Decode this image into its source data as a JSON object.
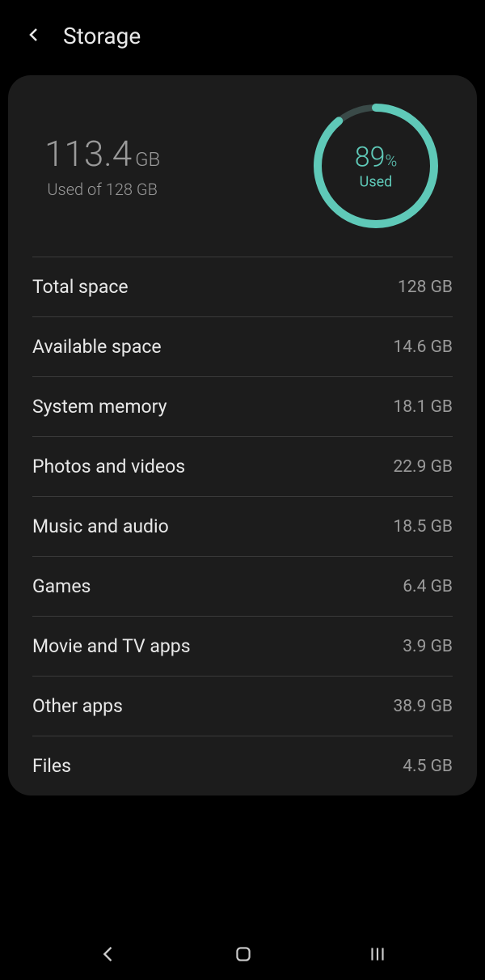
{
  "header": {
    "title": "Storage"
  },
  "usage": {
    "amount": "113.4",
    "unit": "GB",
    "subtitle": "Used of 128 GB",
    "percent": "89",
    "percent_sign": "%",
    "used_label": "Used",
    "gauge_fraction": 0.89
  },
  "rows": [
    {
      "label": "Total space",
      "value": "128 GB"
    },
    {
      "label": "Available space",
      "value": "14.6 GB"
    },
    {
      "label": "System memory",
      "value": "18.1 GB"
    },
    {
      "label": "Photos and videos",
      "value": "22.9 GB"
    },
    {
      "label": "Music and audio",
      "value": "18.5 GB"
    },
    {
      "label": "Games",
      "value": "6.4 GB"
    },
    {
      "label": "Movie and TV apps",
      "value": "3.9 GB"
    },
    {
      "label": "Other apps",
      "value": "38.9 GB"
    },
    {
      "label": "Files",
      "value": "4.5 GB"
    }
  ]
}
